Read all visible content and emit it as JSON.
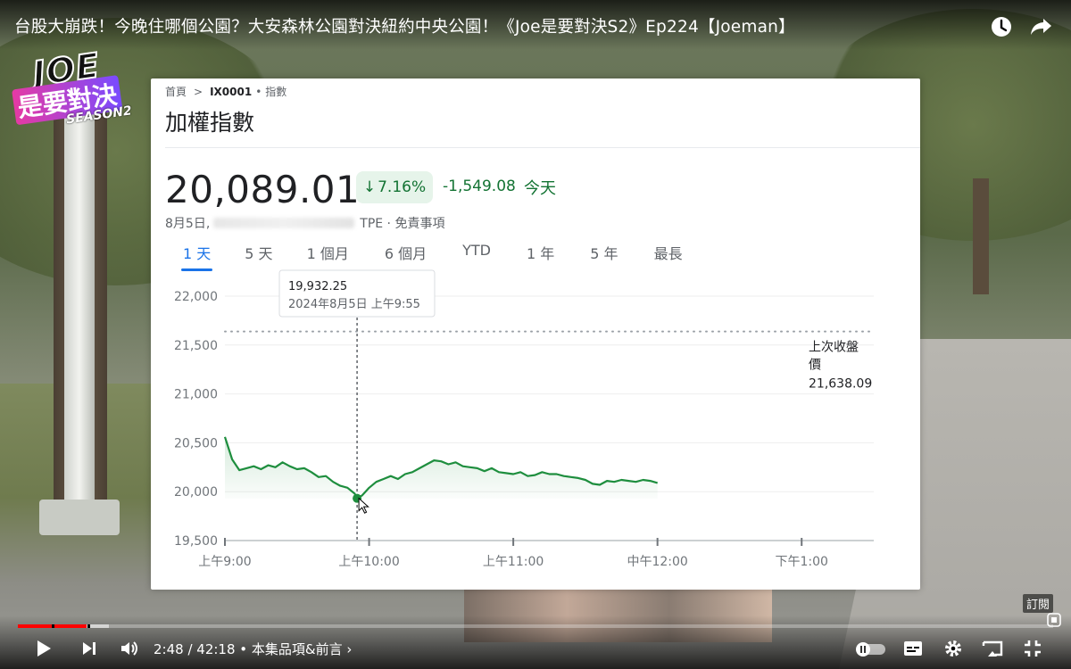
{
  "video": {
    "title": "台股大崩跌！今晚住哪個公園？大安森林公園對決紐約中央公園！《Joe是要對決S2》Ep224【Joeman】",
    "logo": {
      "line1": "JOE",
      "line2": "是要對決",
      "line3": "SEASON2"
    },
    "caption_badge": "訂閱"
  },
  "top_controls": {
    "watch_later_icon": "clock-icon",
    "share_icon": "share-arrow-icon"
  },
  "stock_card": {
    "breadcrumb": {
      "home": "首頁",
      "separator": ">",
      "ticker": "IX0001",
      "dot": "•",
      "type": "指數"
    },
    "name": "加權指數",
    "price": "20,089.01",
    "change_pct": "7.16%",
    "change_arrow": "↓",
    "change_abs": "-1,549.08",
    "change_period": "今天",
    "meta": {
      "date": "8月5日,",
      "exchange": "TPE · 免責事項"
    },
    "tabs": [
      "1 天",
      "5 天",
      "1 個月",
      "6 個月",
      "YTD",
      "1 年",
      "5 年",
      "最長"
    ],
    "active_tab": "1 天",
    "tooltip": {
      "value": "19,932.25",
      "datetime": "2024年8月5日 上午9:55"
    },
    "prev_close": {
      "label_line1": "上次收盤",
      "label_line2": "價",
      "value": "21,638.09"
    }
  },
  "chart_data": {
    "type": "line",
    "title": "",
    "ylim": [
      19500,
      22000
    ],
    "yticks": [
      "22,000",
      "21,500",
      "21,000",
      "20,500",
      "20,000",
      "19,500"
    ],
    "ytick_values": [
      22000,
      21500,
      21000,
      20500,
      20000,
      19500
    ],
    "xticks": [
      "上午9:00",
      "上午10:00",
      "上午11:00",
      "中午12:00",
      "下午1:00"
    ],
    "xtick_minutes": [
      0,
      60,
      120,
      180,
      240
    ],
    "xlim_minutes": [
      0,
      270
    ],
    "reference_line": 21638.09,
    "color": "#1e8e3e",
    "series": [
      {
        "x_minutes": [
          0,
          3,
          6,
          9,
          12,
          15,
          18,
          21,
          24,
          27,
          30,
          33,
          36,
          39,
          42,
          45,
          48,
          51,
          54,
          55,
          57,
          60,
          63,
          66,
          69,
          72,
          75,
          78,
          81,
          84,
          87,
          90,
          93,
          96,
          99,
          102,
          105,
          108,
          111,
          114,
          117,
          120,
          123,
          126,
          129,
          132,
          135,
          138,
          141,
          144,
          147,
          150,
          153,
          156,
          159,
          162,
          165,
          168,
          171,
          174,
          177,
          180
        ],
        "values": [
          20560,
          20330,
          20220,
          20240,
          20260,
          20230,
          20270,
          20250,
          20300,
          20260,
          20230,
          20240,
          20200,
          20150,
          20160,
          20100,
          20060,
          20040,
          19980,
          19932,
          19960,
          20040,
          20100,
          20130,
          20160,
          20130,
          20180,
          20200,
          20240,
          20280,
          20320,
          20310,
          20280,
          20300,
          20260,
          20250,
          20240,
          20210,
          20240,
          20200,
          20190,
          20180,
          20200,
          20160,
          20170,
          20200,
          20180,
          20180,
          20160,
          20150,
          20140,
          20120,
          20080,
          20070,
          20110,
          20100,
          20120,
          20110,
          20100,
          20120,
          20110,
          20089
        ]
      }
    ],
    "hover_index": 19
  },
  "player": {
    "time": "2:48 / 42:18",
    "chapter": "本集品項&前言",
    "chapter_arrow": "›",
    "progress_played": 0.066,
    "progress_buffered": 0.088
  }
}
